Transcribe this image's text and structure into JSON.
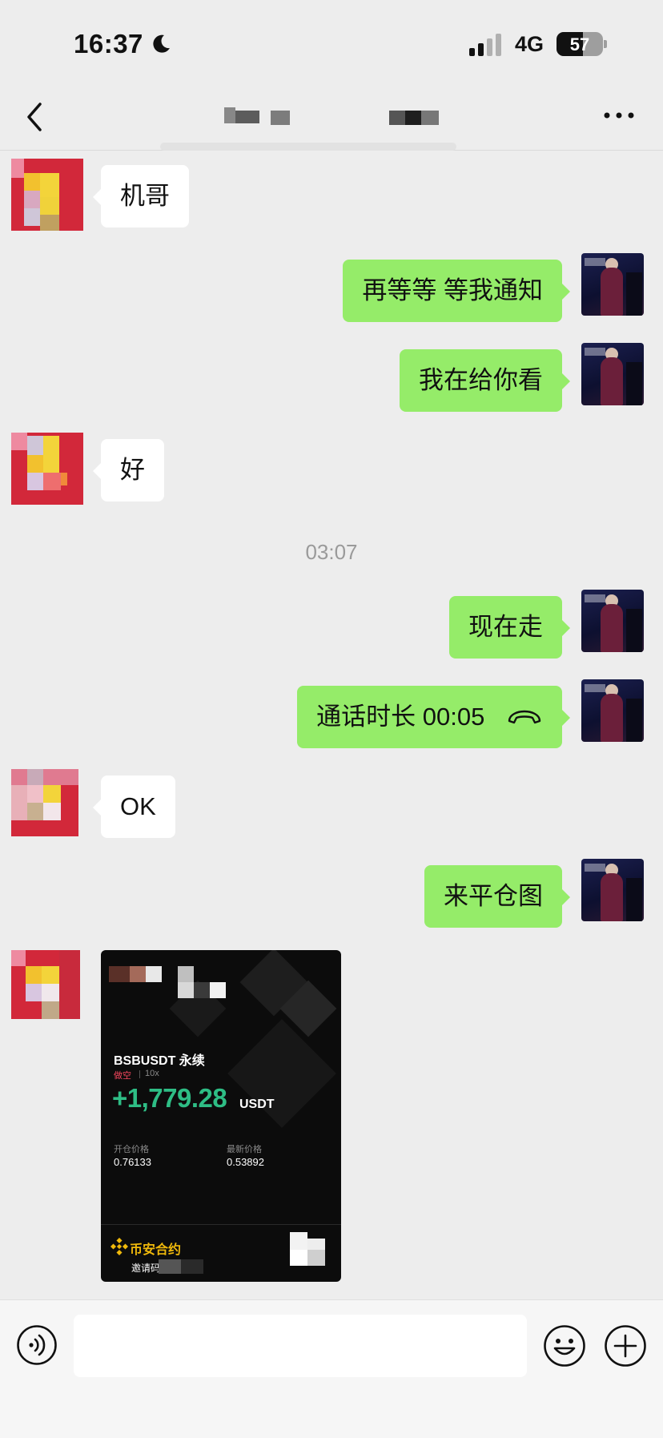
{
  "status_bar": {
    "time": "16:37",
    "network": "4G",
    "battery_level": "57",
    "battery_fraction": 0.57,
    "icons": [
      "moon-icon",
      "signal-icon",
      "battery-icon"
    ]
  },
  "nav": {
    "back_icon": "chevron-left-icon",
    "more_icon": "ellipsis-icon"
  },
  "messages": [
    {
      "side": "left",
      "text": "机哥"
    },
    {
      "side": "right",
      "text": "再等等 等我通知"
    },
    {
      "side": "right",
      "text": "我在给你看"
    },
    {
      "side": "left",
      "text": "好"
    },
    {
      "side": "right",
      "text": "现在走"
    },
    {
      "side": "right",
      "text": "通话时长 00:05",
      "icon": "phone-hangup-icon"
    },
    {
      "side": "left",
      "text": "OK"
    },
    {
      "side": "right",
      "text": "来平仓图"
    }
  ],
  "timestamp": "03:07",
  "image_card": {
    "symbol": "BSBUSDT 永续",
    "side": "做空",
    "leverage": "10x",
    "pnl": "+1,779.28",
    "pnl_unit": "USDT",
    "entry_price_label": "开仓价格",
    "entry_price": "0.76133",
    "last_price_label": "最新价格",
    "last_price": "0.53892",
    "brand": "币安合约",
    "invite_label": "邀请码",
    "colors": {
      "profit": "#2ebd85",
      "short": "#f6465d",
      "brand": "#f0b90b"
    }
  },
  "input_bar": {
    "placeholder": "",
    "icons": [
      "voice-icon",
      "emoji-icon",
      "plus-icon"
    ]
  },
  "colors": {
    "background": "#ededed",
    "outgoing_bubble": "#95ec69",
    "incoming_bubble": "#ffffff"
  }
}
